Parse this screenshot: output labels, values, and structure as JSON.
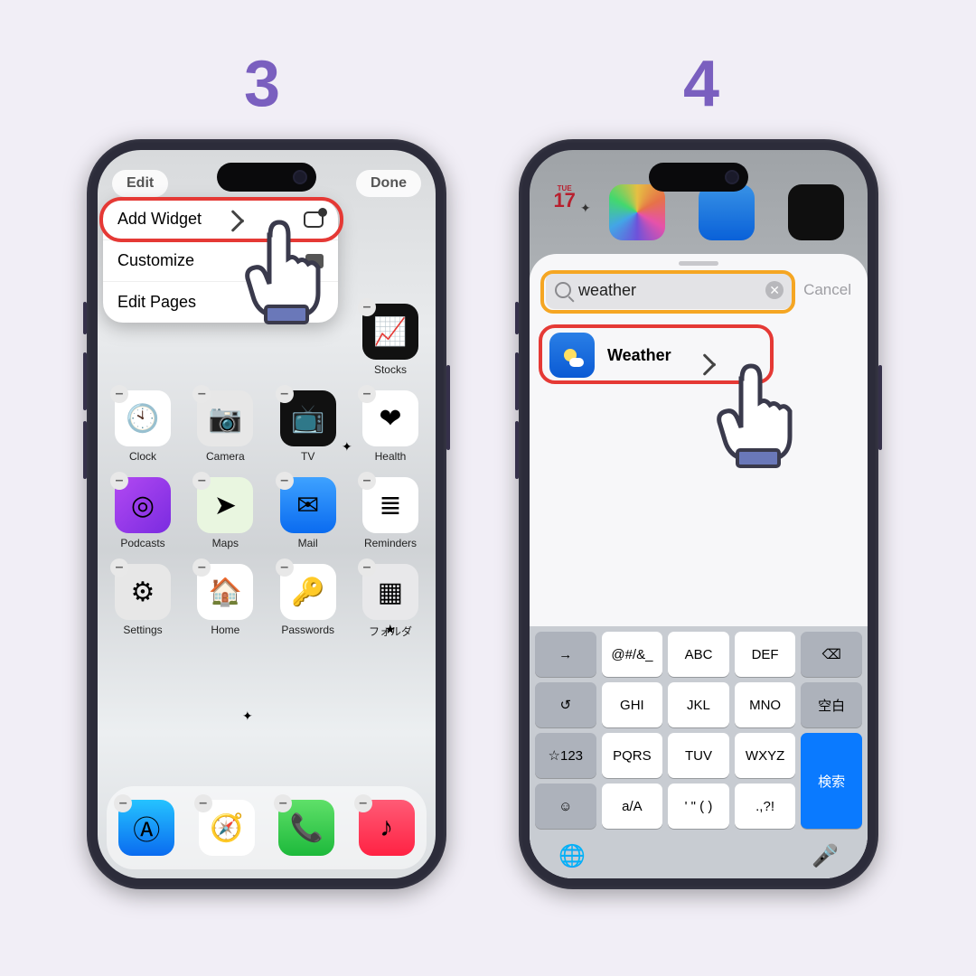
{
  "steps": {
    "s3": "3",
    "s4": "4"
  },
  "phone3": {
    "edit": "Edit",
    "done": "Done",
    "menu": {
      "add": "Add Widget",
      "customize": "Customize",
      "pages": "Edit Pages"
    },
    "apps_r1": [
      {
        "label": "Stocks",
        "glyph": "📈",
        "bg": "#111"
      }
    ],
    "apps_r2": [
      {
        "label": "Clock",
        "glyph": "🕙",
        "bg": "#fff"
      },
      {
        "label": "Camera",
        "glyph": "📷",
        "bg": "#e7e7e7"
      },
      {
        "label": "TV",
        "glyph": "📺",
        "bg": "#111"
      },
      {
        "label": "Health",
        "glyph": "❤",
        "bg": "#fff"
      }
    ],
    "apps_r3": [
      {
        "label": "Podcasts",
        "glyph": "◎",
        "bg": "linear-gradient(135deg,#b249f2,#7a2be0)"
      },
      {
        "label": "Maps",
        "glyph": "➤",
        "bg": "#e9f6e0"
      },
      {
        "label": "Mail",
        "glyph": "✉",
        "bg": "linear-gradient(180deg,#3ea2ff,#0a6bf0)"
      },
      {
        "label": "Reminders",
        "glyph": "≣",
        "bg": "#fff"
      }
    ],
    "apps_r4": [
      {
        "label": "Settings",
        "glyph": "⚙",
        "bg": "#e7e7e7"
      },
      {
        "label": "Home",
        "glyph": "🏠",
        "bg": "#fff"
      },
      {
        "label": "Passwords",
        "glyph": "🔑",
        "bg": "#fff"
      },
      {
        "label": "フォルダ",
        "glyph": "▦",
        "bg": "#e8e8ea"
      }
    ],
    "dock": [
      {
        "name": "app-store-icon",
        "glyph": "Ⓐ",
        "bg": "linear-gradient(180deg,#25c3ff,#0a6bf0)"
      },
      {
        "name": "safari-icon",
        "glyph": "🧭",
        "bg": "#fff"
      },
      {
        "name": "phone-icon",
        "glyph": "📞",
        "bg": "linear-gradient(180deg,#5fe069,#1db93b)"
      },
      {
        "name": "music-icon",
        "glyph": "♪",
        "bg": "linear-gradient(180deg,#ff5b76,#ff2243)"
      }
    ]
  },
  "phone4": {
    "day": "TUE",
    "search": "weather",
    "cancel": "Cancel",
    "result": "Weather",
    "kb": {
      "row1": [
        "→",
        "@#/&_",
        "ABC",
        "DEF",
        "⌫"
      ],
      "row2": [
        "↺",
        "GHI",
        "JKL",
        "MNO",
        "空白"
      ],
      "row3": [
        "☆123",
        "PQRS",
        "TUV",
        "WXYZ",
        "検索"
      ],
      "row4": [
        "☺",
        "a/A",
        "' \" ( )",
        ".,?!",
        ""
      ]
    }
  }
}
